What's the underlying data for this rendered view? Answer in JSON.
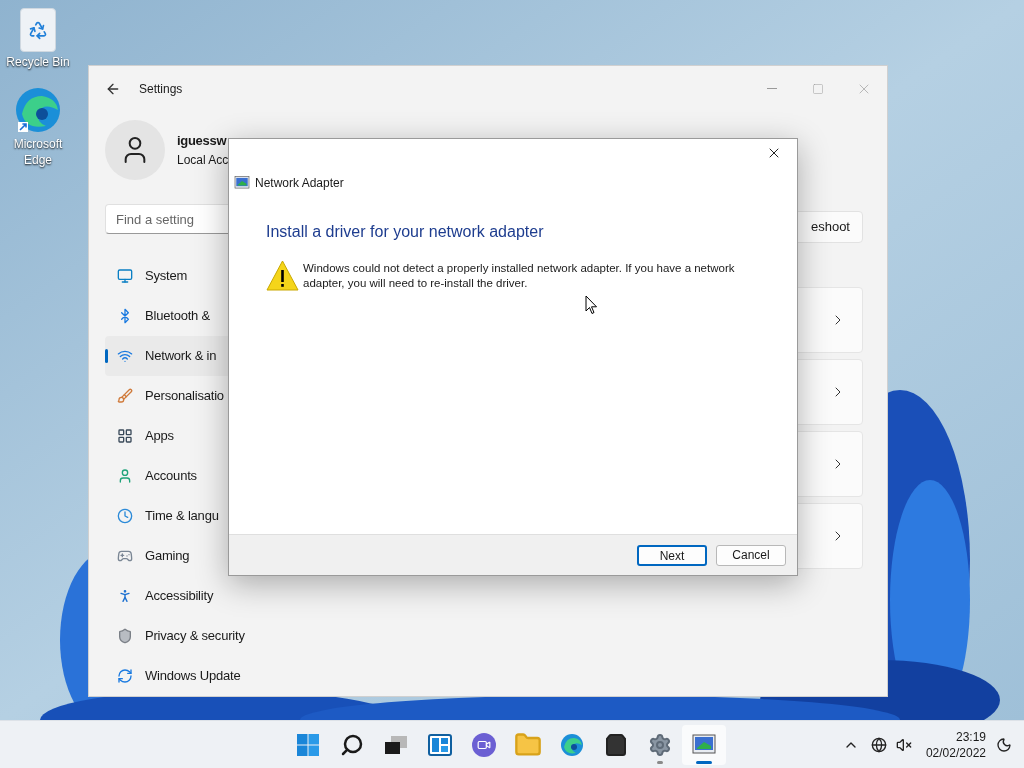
{
  "desktop": {
    "icons": [
      {
        "label": "Recycle Bin",
        "kind": "recycle"
      },
      {
        "label": "Microsoft Edge",
        "kind": "edge"
      }
    ]
  },
  "settings": {
    "title": "Settings",
    "user": {
      "name": "iguessw",
      "account": "Local Acc"
    },
    "search": {
      "placeholder": "Find a setting"
    },
    "nav": [
      {
        "label": "System",
        "kind": "system",
        "selected": false
      },
      {
        "label": "Bluetooth &",
        "kind": "bluetooth",
        "selected": false
      },
      {
        "label": "Network & in",
        "kind": "network",
        "selected": true
      },
      {
        "label": "Personalisatio",
        "kind": "personalisation",
        "selected": false
      },
      {
        "label": "Apps",
        "kind": "apps",
        "selected": false
      },
      {
        "label": "Accounts",
        "kind": "accounts",
        "selected": false
      },
      {
        "label": "Time & langu",
        "kind": "time",
        "selected": false
      },
      {
        "label": "Gaming",
        "kind": "gaming",
        "selected": false
      },
      {
        "label": "Accessibility",
        "kind": "accessibility",
        "selected": false
      },
      {
        "label": "Privacy & security",
        "kind": "privacy",
        "selected": false
      },
      {
        "label": "Windows Update",
        "kind": "update",
        "selected": false
      }
    ],
    "troubleshoot": "eshoot",
    "cards": [
      {
        "kind": "link"
      },
      {
        "kind": "link"
      },
      {
        "kind": "link"
      },
      {
        "kind": "link"
      }
    ]
  },
  "dialog": {
    "title": "Network Adapter",
    "heading": "Install a driver for your network adapter",
    "message": "Windows could not detect a properly installed network adapter. If you have a network adapter, you will need to re-install the driver.",
    "buttons": [
      {
        "label": "Next",
        "default": true
      },
      {
        "label": "Cancel",
        "default": false
      }
    ]
  },
  "taskbar": {
    "apps": [
      {
        "kind": "start",
        "running": false,
        "active": false
      },
      {
        "kind": "search",
        "running": false,
        "active": false
      },
      {
        "kind": "taskview",
        "running": false,
        "active": false
      },
      {
        "kind": "widgets",
        "running": false,
        "active": false
      },
      {
        "kind": "chat",
        "running": false,
        "active": false
      },
      {
        "kind": "explorer",
        "running": false,
        "active": false
      },
      {
        "kind": "edge",
        "running": false,
        "active": false
      },
      {
        "kind": "store",
        "running": false,
        "active": false
      },
      {
        "kind": "settings",
        "running": true,
        "active": false
      },
      {
        "kind": "adapter",
        "running": true,
        "active": true
      }
    ],
    "time": "23:19",
    "date": "02/02/2022"
  }
}
